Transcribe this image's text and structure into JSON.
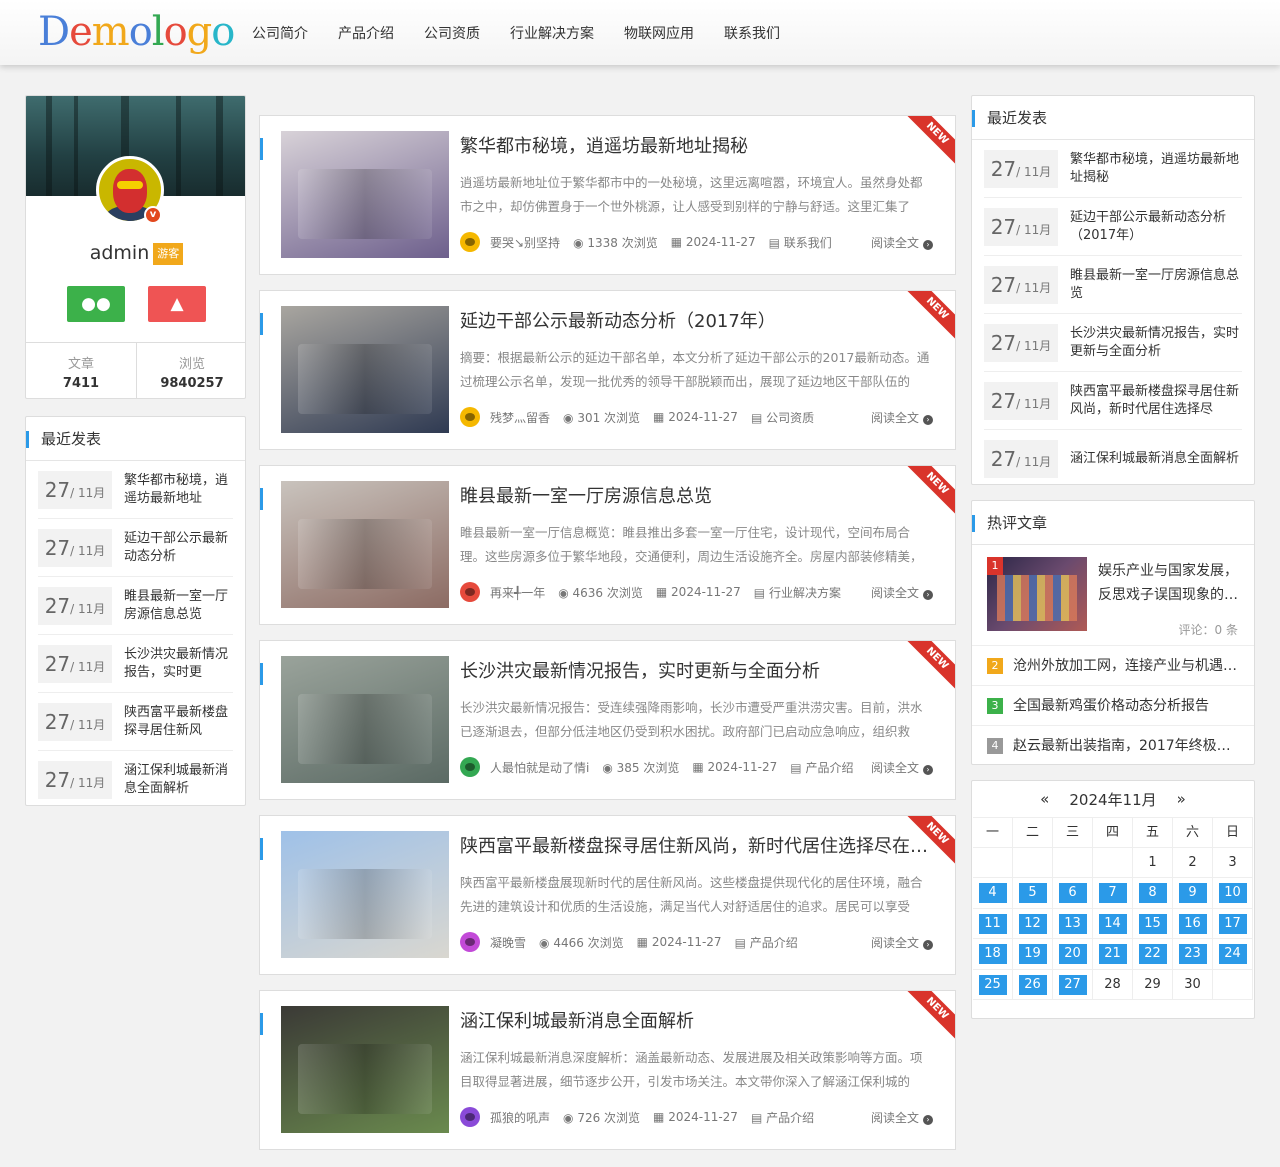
{
  "logo": {
    "text": "Demologo",
    "letters": [
      "D",
      "e",
      "m",
      "o",
      "l",
      "o",
      "g",
      "o"
    ]
  },
  "nav": [
    "公司简介",
    "产品介绍",
    "公司资质",
    "行业解决方案",
    "物联网应用",
    "联系我们"
  ],
  "profile": {
    "name": "admin",
    "badge": "游客",
    "v_badge": "v",
    "articles_label": "文章",
    "articles": "7411",
    "views_label": "浏览",
    "views": "9840257",
    "wechat_icon": "wechat-icon",
    "qq_icon": "qq-icon"
  },
  "left_recent": {
    "title": "最近发表",
    "items": [
      {
        "day": "27",
        "month": "/ 11月",
        "title": "繁华都市秘境，逍遥坊最新地址"
      },
      {
        "day": "27",
        "month": "/ 11月",
        "title": "延边干部公示最新动态分析"
      },
      {
        "day": "27",
        "month": "/ 11月",
        "title": "睢县最新一室一厅房源信息总览"
      },
      {
        "day": "27",
        "month": "/ 11月",
        "title": "长沙洪灾最新情况报告，实时更"
      },
      {
        "day": "27",
        "month": "/ 11月",
        "title": "陕西富平最新楼盘探寻居住新风"
      },
      {
        "day": "27",
        "month": "/ 11月",
        "title": "涵江保利城最新消息全面解析"
      }
    ]
  },
  "articles": [
    {
      "title": "繁华都市秘境，逍遥坊最新地址揭秘",
      "summary": "逍遥坊最新地址位于繁华都市中的一处秘境，这里远离喧嚣，环境宜人。虽然身处都市之中，却仿佛置身于一个世外桃源，让人感受到别样的宁静与舒适。这里汇集了",
      "author": "要哭↘别坚持",
      "views": "1338 次浏览",
      "date": "2024-11-27",
      "category": "联系我们",
      "read": "阅读全文",
      "badge": "NEW",
      "avatar_color": "#f5b800",
      "thumb_colors": [
        "#d8d2d8",
        "#6d5f8c"
      ]
    },
    {
      "title": "延边干部公示最新动态分析（2017年）",
      "summary": "摘要：根据最新公示的延边干部名单，本文分析了延边干部公示的2017最新动态。通过梳理公示名单，发现一批优秀的领导干部脱颖而出，展现了延边地区干部队伍的",
      "author": "残梦灬留香",
      "views": "301 次浏览",
      "date": "2024-11-27",
      "category": "公司资质",
      "read": "阅读全文",
      "badge": "NEW",
      "avatar_color": "#f5b800",
      "thumb_colors": [
        "#a9a6a0",
        "#2f3a52"
      ]
    },
    {
      "title": "睢县最新一室一厅房源信息总览",
      "summary": "睢县最新一室一厅信息概览：睢县推出多套一室一厅住宅，设计现代，空间布局合理。这些房源多位于繁华地段，交通便利，周边生活设施齐全。房屋内部装修精美，",
      "author": "再来╃一年",
      "views": "4636 次浏览",
      "date": "2024-11-27",
      "category": "行业解决方案",
      "read": "阅读全文",
      "badge": "NEW",
      "avatar_color": "#e64a3c",
      "thumb_colors": [
        "#c9c3bd",
        "#8c6b63"
      ]
    },
    {
      "title": "长沙洪灾最新情况报告，实时更新与全面分析",
      "summary": "长沙洪灾最新情况报告：受连续强降雨影响，长沙市遭受严重洪涝灾害。目前，洪水已逐渐退去，但部分低洼地区仍受到积水困扰。政府部门已启动应急响应，组织救",
      "author": "人最怕就是动了情i",
      "views": "385 次浏览",
      "date": "2024-11-27",
      "category": "产品介绍",
      "read": "阅读全文",
      "badge": "NEW",
      "avatar_color": "#33a852",
      "thumb_colors": [
        "#9aa39b",
        "#5b6a64"
      ]
    },
    {
      "title": "陕西富平最新楼盘探寻居住新风尚，新时代居住选择尽在富平",
      "summary": "陕西富平最新楼盘展现新时代的居住新风尚。这些楼盘提供现代化的居住环境，融合先进的建筑设计和优质的生活设施，满足当代人对舒适居住的追求。居民可以享受",
      "author": "凝晚雪",
      "views": "4466 次浏览",
      "date": "2024-11-27",
      "category": "产品介绍",
      "read": "阅读全文",
      "badge": "NEW",
      "avatar_color": "#c24ad8",
      "thumb_colors": [
        "#9fc1e8",
        "#d9d7d0"
      ]
    },
    {
      "title": "涵江保利城最新消息全面解析",
      "summary": "涵江保利城最新消息深度解析：涵盖最新动态、发展进展及相关政策影响等方面。项目取得显著进展，细节逐步公开，引发市场关注。本文带你深入了解涵江保利城的",
      "author": "孤狼的吼声",
      "views": "726 次浏览",
      "date": "2024-11-27",
      "category": "产品介绍",
      "read": "阅读全文",
      "badge": "NEW",
      "avatar_color": "#8a4ad8",
      "thumb_colors": [
        "#3b3a36",
        "#6a8a4e"
      ]
    }
  ],
  "right_recent": {
    "title": "最近发表",
    "items": [
      {
        "day": "27",
        "month": "/ 11月",
        "title": "繁华都市秘境，逍遥坊最新地址揭秘"
      },
      {
        "day": "27",
        "month": "/ 11月",
        "title": "延边干部公示最新动态分析（2017年）"
      },
      {
        "day": "27",
        "month": "/ 11月",
        "title": "睢县最新一室一厅房源信息总览"
      },
      {
        "day": "27",
        "month": "/ 11月",
        "title": "长沙洪灾最新情况报告，实时更新与全面分析"
      },
      {
        "day": "27",
        "month": "/ 11月",
        "title": "陕西富平最新楼盘探寻居住新风尚，新时代居住选择尽"
      },
      {
        "day": "27",
        "month": "/ 11月",
        "title": "涵江保利城最新消息全面解析"
      }
    ]
  },
  "hot": {
    "title": "热评文章",
    "first": {
      "rank": "1",
      "title": "娱乐产业与国家发展，反思戏子误国现象的…",
      "comments": "评论：0 条"
    },
    "items": [
      {
        "rank": "2",
        "title": "沧州外放加工网，连接产业与机遇…",
        "color": "#f1a81b"
      },
      {
        "rank": "3",
        "title": "全国最新鸡蛋价格动态分析报告",
        "color": "#3cb14a"
      },
      {
        "rank": "4",
        "title": "赵云最新出装指南，2017年终极…",
        "color": "#999999"
      }
    ]
  },
  "calendar": {
    "prev": "«",
    "next": "»",
    "title": "2024年11月",
    "weekdays": [
      "一",
      "二",
      "三",
      "四",
      "五",
      "六",
      "日"
    ],
    "cells": [
      "",
      "",
      "",
      "",
      "1",
      "2",
      "3",
      "4",
      "5",
      "6",
      "7",
      "8",
      "9",
      "10",
      "11",
      "12",
      "13",
      "14",
      "15",
      "16",
      "17",
      "18",
      "19",
      "20",
      "21",
      "22",
      "23",
      "24",
      "25",
      "26",
      "27",
      "28",
      "29",
      "30",
      ""
    ],
    "linked": [
      "4",
      "5",
      "6",
      "7",
      "8",
      "9",
      "10",
      "11",
      "12",
      "13",
      "14",
      "15",
      "16",
      "17",
      "18",
      "19",
      "20",
      "21",
      "22",
      "23",
      "24",
      "25",
      "26",
      "27"
    ]
  },
  "colors": {
    "accent": "#2b9ae8",
    "ribbon": "#d9342b",
    "wechat": "#3cb14a",
    "qq": "#ef5454",
    "badge": "#f1a81b"
  }
}
